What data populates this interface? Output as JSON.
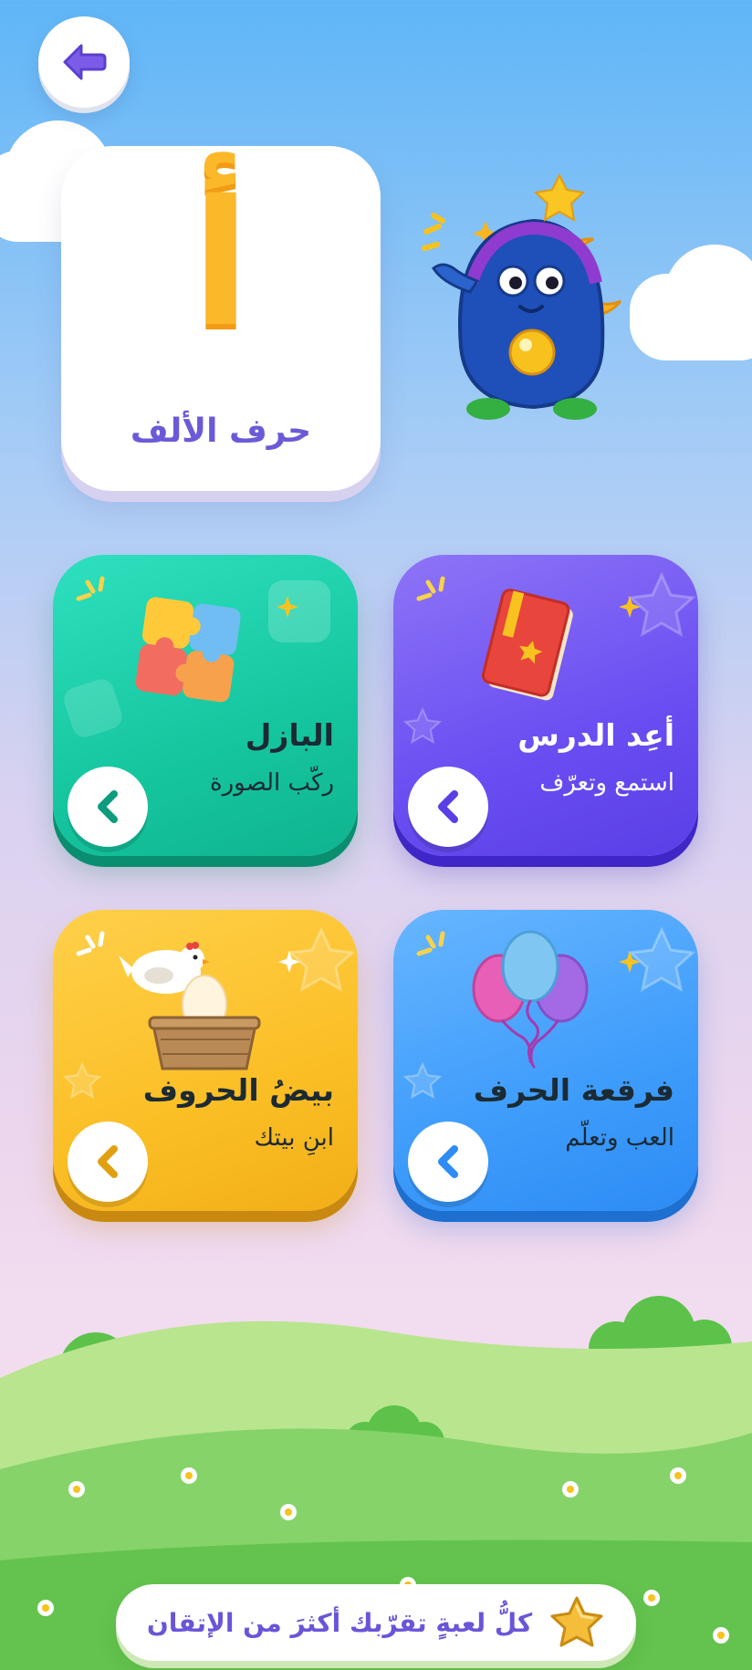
{
  "header": {
    "back_icon": "arrow-left-icon"
  },
  "letter": {
    "glyph": "أ",
    "name": "حرف الألف",
    "color": "#fbb829"
  },
  "mascot": {
    "icon": "blue-monster-mascot"
  },
  "cards": [
    {
      "title": "البازل",
      "subtitle": "ركّب الصورة",
      "icon": "puzzle-icon",
      "color": "#15c69f"
    },
    {
      "title": "أعِد الدرس",
      "subtitle": "استمع وتعرّف",
      "icon": "book-icon",
      "color": "#6a4ef2"
    },
    {
      "title": "بيضُ الحروف",
      "subtitle": "ابنِ بيتك",
      "icon": "hen-egg-icon",
      "color": "#fbbf26"
    },
    {
      "title": "فرقعة الحرف",
      "subtitle": "العب وتعلّم",
      "icon": "balloons-icon",
      "color": "#3e9cfb"
    }
  ],
  "footer": {
    "text": "كلُّ لعبةٍ تقرّبك أكثرَ من الإتقان",
    "icon": "star-icon"
  }
}
